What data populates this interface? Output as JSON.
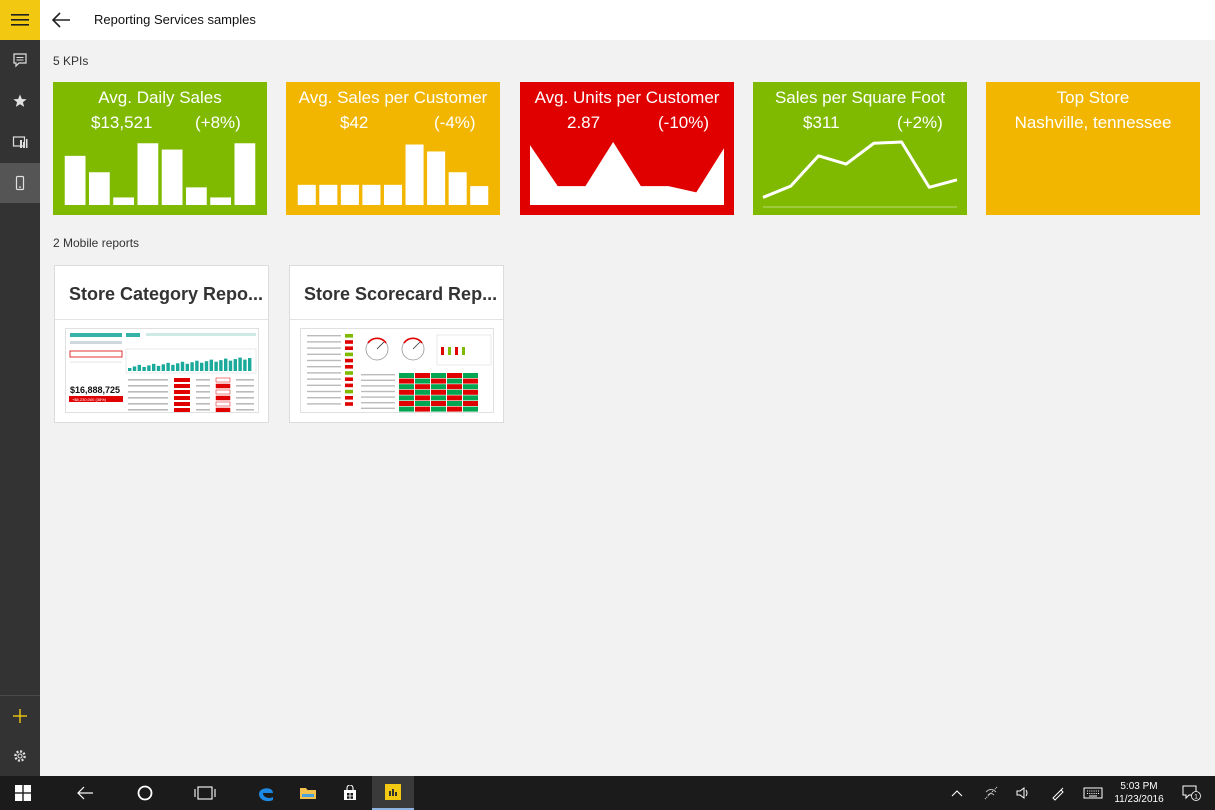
{
  "app": {
    "title": "Reporting Services samples"
  },
  "kpi_section": {
    "label": "5 KPIs",
    "kpis": [
      {
        "title": "Avg. Daily Sales",
        "value": "$13,521",
        "delta": "(+8%)",
        "color": "#7fba00",
        "viz": "bar",
        "series": [
          0.78,
          0.52,
          0.12,
          0.98,
          0.88,
          0.28,
          0.12,
          0.98
        ]
      },
      {
        "title": "Avg. Sales per Customer",
        "value": "$42",
        "delta": "(-4%)",
        "color": "#f2b600",
        "viz": "bar",
        "series": [
          0.32,
          0.32,
          0.32,
          0.32,
          0.32,
          0.96,
          0.85,
          0.52,
          0.3
        ]
      },
      {
        "title": "Avg. Units per Customer",
        "value": "2.87",
        "delta": "(-10%)",
        "color": "#e00000",
        "viz": "area",
        "series": [
          0.95,
          0.3,
          0.3,
          1.0,
          0.3,
          0.3,
          0.2,
          0.9
        ]
      },
      {
        "title": "Sales per Square Foot",
        "value": "$311",
        "delta": "(+2%)",
        "color": "#7fba00",
        "viz": "line",
        "series": [
          0.12,
          0.3,
          0.78,
          0.65,
          0.98,
          1.0,
          0.28,
          0.4
        ]
      },
      {
        "title": "Top Store",
        "subtitle": "Nashville, tennessee",
        "color": "#f2b600",
        "viz": "none"
      }
    ]
  },
  "reports_section": {
    "label": "2 Mobile reports",
    "reports": [
      {
        "title": "Store Category Repo...",
        "thumb_value": "$16,888,725",
        "thumb_sub": "+$8,230,000 (38%)"
      },
      {
        "title": "Store Scorecard Rep..."
      }
    ]
  },
  "taskbar": {
    "time": "5:03 PM",
    "date": "11/23/2016",
    "notifications": "1"
  },
  "colors": {
    "accent": "#f2c811",
    "rail": "#333333",
    "green": "#7fba00",
    "yellow": "#f2b600",
    "red": "#e00000"
  },
  "icons": [
    "hamburger-icon",
    "chat-icon",
    "star-icon",
    "reports-icon",
    "mobile-icon",
    "plus-icon",
    "gear-icon",
    "back-arrow-icon"
  ]
}
